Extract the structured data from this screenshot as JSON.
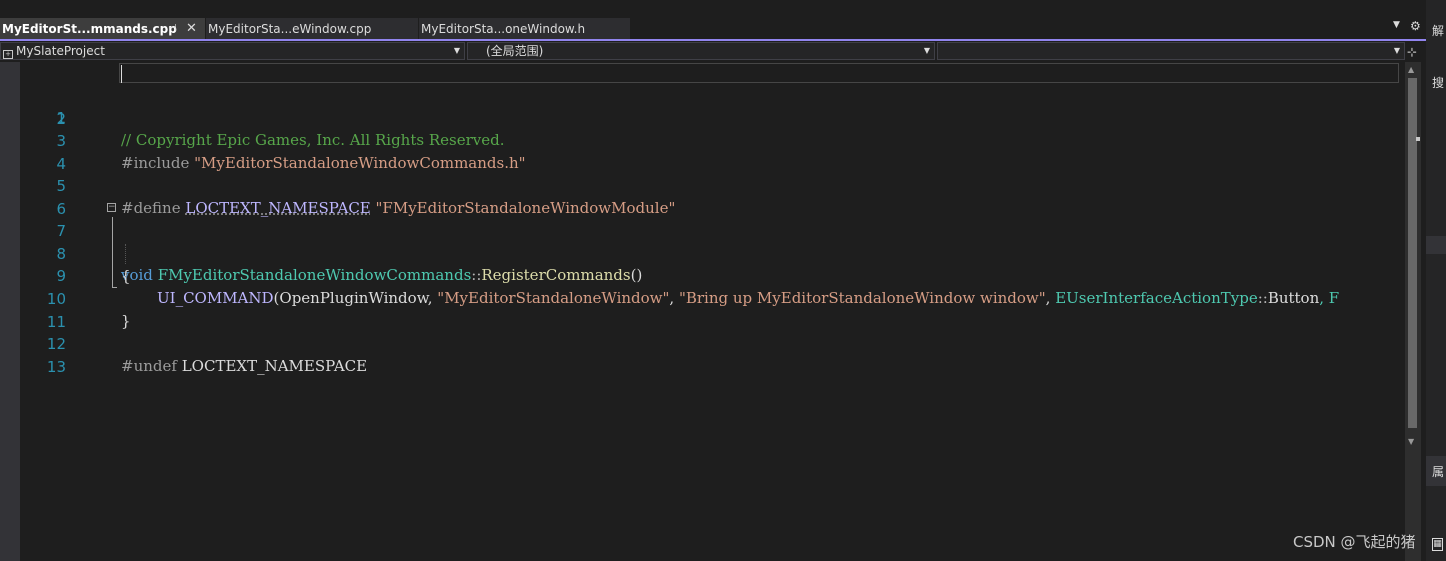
{
  "tabs": [
    {
      "label": "MyEditorSt...mmands.cpp",
      "active": true
    },
    {
      "label": "MyEditorSta...eWindow.cpp",
      "active": false
    },
    {
      "label": "MyEditorSta...oneWindow.h",
      "active": false
    }
  ],
  "navbar": {
    "project": "MySlateProject",
    "scope": "(全局范围)",
    "member": ""
  },
  "code": {
    "line_numbers": [
      "1",
      "2",
      "3",
      "4",
      "5",
      "6",
      "7",
      "8",
      "9",
      "10",
      "11",
      "12",
      "13"
    ],
    "l1_comment": "// Copyright Epic Games, Inc. All Rights Reserved.",
    "l3_directive": "#include ",
    "l3_string": "\"MyEditorStandaloneWindowCommands.h\"",
    "l5_directive": "#define ",
    "l5_macro": "LOCTEXT_NAMESPACE",
    "l5_space": " ",
    "l5_string": "\"FMyEditorStandaloneWindowModule\"",
    "l7_keyword": "void",
    "l7_space": " ",
    "l7_class": "FMyEditorStandaloneWindowCommands",
    "l7_scope": "::",
    "l7_func": "RegisterCommands",
    "l7_parens": "()",
    "l8_brace": "{",
    "l9_macro": "UI_COMMAND",
    "l9_args_1": "(OpenPluginWindow, ",
    "l9_string_1": "\"MyEditorStandaloneWindow\"",
    "l9_comma_1": ", ",
    "l9_string_2": "\"Bring up MyEditorStandaloneWindow window\"",
    "l9_comma_2": ", ",
    "l9_type": "EUserInterfaceActionType",
    "l9_scope": "::",
    "l9_member": "Button",
    "l9_tail": ", F",
    "l10_brace": "}",
    "l12_directive": "#undef ",
    "l12_plain": "LOCTEXT_NAMESPACE"
  },
  "right_panel": {
    "char_1": "解",
    "char_2": "搜",
    "char_3": "属"
  },
  "watermark": "CSDN @飞起的猪",
  "colors": {
    "accent": "#9184ee",
    "comment": "#57a64a",
    "string": "#d69d85",
    "macro": "#beb7ff",
    "keyword": "#569cd6",
    "type": "#4ec9b0",
    "function": "#dcdcaa",
    "line_number": "#2b91af"
  },
  "icons": [
    "pin-icon",
    "close-icon",
    "dropdown-icon",
    "gear-icon",
    "project-icon",
    "split-icon",
    "collapse-icon"
  ]
}
